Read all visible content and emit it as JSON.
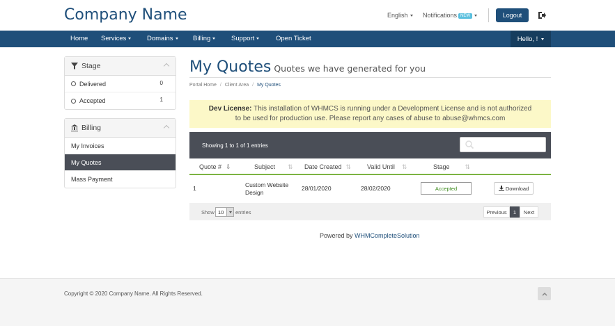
{
  "header": {
    "brand": "Company Name",
    "language": "English",
    "notifications": "Notifications",
    "notifications_badge": "NEW",
    "logout": "Logout"
  },
  "nav": {
    "items": [
      "Home",
      "Services",
      "Domains",
      "Billing",
      "Support",
      "Open Ticket"
    ],
    "account": "Hello, !"
  },
  "sidebar": {
    "stage": {
      "title": "Stage",
      "items": [
        {
          "label": "Delivered",
          "count": "0"
        },
        {
          "label": "Accepted",
          "count": "1"
        }
      ]
    },
    "billing": {
      "title": "Billing",
      "items": [
        "My Invoices",
        "My Quotes",
        "Mass Payment"
      ]
    }
  },
  "page": {
    "title": "My Quotes",
    "subtitle": "Quotes we have generated for you",
    "breadcrumb": [
      "Portal Home",
      "Client Area",
      "My Quotes"
    ]
  },
  "dev_license": {
    "label": "Dev License:",
    "line1": " This installation of WHMCS is running under a Development License and is not authorized",
    "line2": "to be used for production use. Please report any cases of abuse to abuse@whmcs.com"
  },
  "table": {
    "showing": "Showing 1 to 1 of 1 entries",
    "columns": [
      "Quote #",
      "Subject",
      "Date Created",
      "Valid Until",
      "Stage"
    ],
    "rows": [
      {
        "quote": "1",
        "subject_line1": "Custom Website",
        "subject_line2": "Design",
        "date_created": "28/01/2020",
        "valid_until": "28/02/2020",
        "stage": "Accepted",
        "action": "Download"
      }
    ],
    "show_label": "Show",
    "length": "10",
    "entries_label": "entries",
    "pagination": {
      "previous": "Previous",
      "current": "1",
      "next": "Next"
    }
  },
  "powered": {
    "prefix": "Powered by ",
    "link": "WHMCompleteSolution"
  },
  "footer": {
    "copyright": "Copyright © 2020 Company Name. All Rights Reserved."
  },
  "colors": {
    "primary": "#1f4f7a",
    "dark": "#4a4e57",
    "success": "#7cb342",
    "notice": "#fcf8c8"
  }
}
